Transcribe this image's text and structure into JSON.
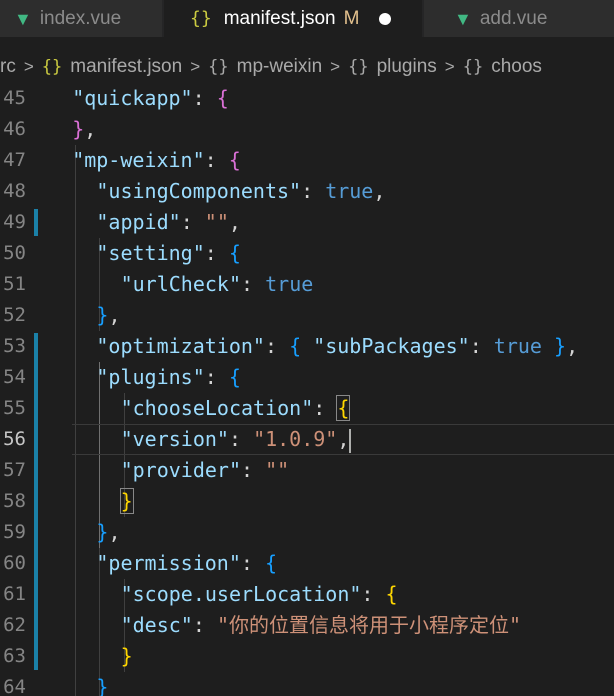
{
  "tabs": [
    {
      "label": "index.vue",
      "icon": "vue-icon"
    },
    {
      "label": "manifest.json",
      "icon": "json-braces-icon",
      "badge": "M",
      "active": true
    },
    {
      "label": "add.vue",
      "icon": "vue-icon"
    }
  ],
  "breadcrumb": {
    "items": [
      "rc",
      "manifest.json",
      "mp-weixin",
      "plugins",
      "choos"
    ],
    "json_icon": "{}",
    "obj_icon": "{}",
    "separator": ">"
  },
  "editor": {
    "active_line": "56",
    "lines": [
      {
        "n": "45",
        "tokens": [
          [
            "k",
            "\"quickapp\""
          ],
          [
            "p",
            ": "
          ],
          [
            "br1",
            "{"
          ]
        ]
      },
      {
        "n": "46",
        "tokens": [
          [
            "br1",
            "}"
          ],
          [
            "p",
            ","
          ]
        ]
      },
      {
        "n": "47",
        "tokens": [
          [
            "k",
            "\"mp-weixin\""
          ],
          [
            "p",
            ": "
          ],
          [
            "br1",
            "{"
          ]
        ]
      },
      {
        "n": "48",
        "tokens": [
          [
            "k",
            "\"usingComponents\""
          ],
          [
            "p",
            ": "
          ],
          [
            "b",
            "true"
          ],
          [
            "p",
            ","
          ]
        ]
      },
      {
        "n": "49",
        "tokens": [
          [
            "k",
            "\"appid\""
          ],
          [
            "p",
            ": "
          ],
          [
            "s",
            "\"\""
          ],
          [
            "p",
            ","
          ]
        ]
      },
      {
        "n": "50",
        "tokens": [
          [
            "k",
            "\"setting\""
          ],
          [
            "p",
            ": "
          ],
          [
            "br2",
            "{"
          ]
        ]
      },
      {
        "n": "51",
        "tokens": [
          [
            "k",
            "\"urlCheck\""
          ],
          [
            "p",
            ": "
          ],
          [
            "b",
            "true"
          ]
        ]
      },
      {
        "n": "52",
        "tokens": [
          [
            "br2",
            "}"
          ],
          [
            "p",
            ","
          ]
        ]
      },
      {
        "n": "53",
        "tokens": [
          [
            "k",
            "\"optimization\""
          ],
          [
            "p",
            ": "
          ],
          [
            "br2",
            "{"
          ],
          [
            "p",
            " "
          ],
          [
            "k",
            "\"subPackages\""
          ],
          [
            "p",
            ": "
          ],
          [
            "b",
            "true"
          ],
          [
            "p",
            " "
          ],
          [
            "br2",
            "}"
          ],
          [
            "p",
            ","
          ]
        ]
      },
      {
        "n": "54",
        "tokens": [
          [
            "k",
            "\"plugins\""
          ],
          [
            "p",
            ": "
          ],
          [
            "br2",
            "{"
          ]
        ]
      },
      {
        "n": "55",
        "tokens": [
          [
            "k",
            "\"chooseLocation\""
          ],
          [
            "p",
            ": "
          ],
          [
            "br3box",
            "{"
          ]
        ]
      },
      {
        "n": "56",
        "tokens": [
          [
            "k",
            "\"version\""
          ],
          [
            "p",
            ": "
          ],
          [
            "s",
            "\"1.0.9\""
          ],
          [
            "p",
            ","
          ]
        ]
      },
      {
        "n": "57",
        "tokens": [
          [
            "k",
            "\"provider\""
          ],
          [
            "p",
            ": "
          ],
          [
            "s",
            "\"\""
          ]
        ]
      },
      {
        "n": "58",
        "tokens": [
          [
            "br3box",
            "}"
          ]
        ]
      },
      {
        "n": "59",
        "tokens": [
          [
            "br2",
            "}"
          ],
          [
            "p",
            ","
          ]
        ]
      },
      {
        "n": "60",
        "tokens": [
          [
            "k",
            "\"permission\""
          ],
          [
            "p",
            ": "
          ],
          [
            "br2",
            "{"
          ]
        ]
      },
      {
        "n": "61",
        "tokens": [
          [
            "k",
            "\"scope.userLocation\""
          ],
          [
            "p",
            ": "
          ],
          [
            "br3",
            "{"
          ]
        ]
      },
      {
        "n": "62",
        "tokens": [
          [
            "k",
            "\"desc\""
          ],
          [
            "p",
            ": "
          ],
          [
            "s",
            "\"你的位置信息将用于小程序定位\""
          ]
        ]
      },
      {
        "n": "63",
        "tokens": [
          [
            "br3",
            "}"
          ]
        ]
      },
      {
        "n": "64",
        "tokens": [
          [
            "br2",
            "}"
          ]
        ]
      }
    ]
  },
  "colors": {
    "editor_bg": "#1e1e1e",
    "key": "#9cdcfe",
    "string": "#ce9178",
    "boolean": "#569cd6",
    "modified_badge": "#e2c08d",
    "vue_icon": "#41b883",
    "json_icon": "#cbcb41"
  }
}
